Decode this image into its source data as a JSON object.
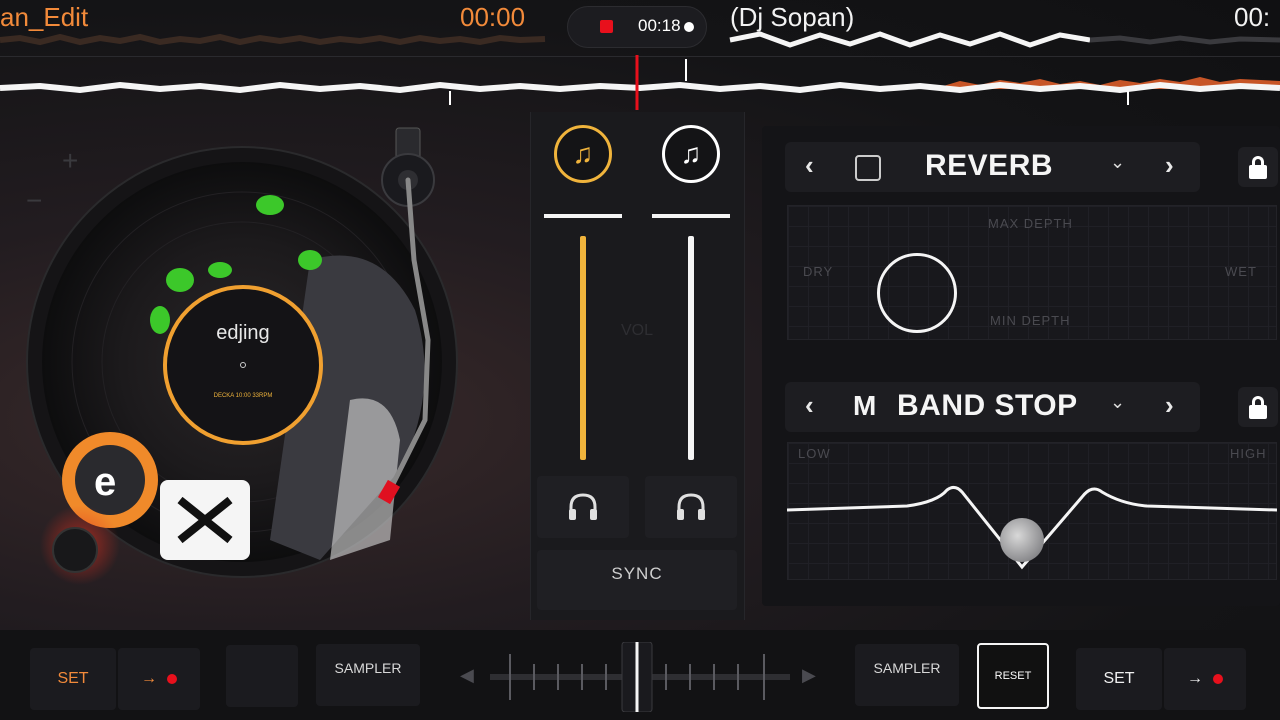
{
  "top": {
    "left_title": "an_Edit",
    "left_time": "00:00",
    "record_time": "00:18",
    "right_title": "(Dj Sopan)",
    "right_time": "00:"
  },
  "deck": {
    "label_brand": "edjing",
    "label_sub": "DECKA 10:00 33RPM",
    "plus_label": "+",
    "minus_label": "−"
  },
  "mixer": {
    "vol_label": "VOL",
    "sync_label": "SYNC",
    "left_music_icon": "music-note-icon",
    "right_music_icon": "music-note-icon",
    "accent": "#f0b43c"
  },
  "fx": {
    "top": {
      "name": "REVERB",
      "max_label": "MAX DEPTH",
      "min_label": "MIN DEPTH",
      "dry_label": "DRY",
      "wet_label": "WET"
    },
    "bottom": {
      "name": "BAND STOP",
      "low_label": "LOW",
      "high_label": "HIGH"
    }
  },
  "bottom": {
    "left_set": "SET",
    "left_sampler": "SAMPLER",
    "right_sampler": "SAMPLER",
    "reset": "RESET",
    "right_set": "SET",
    "arrow": "→"
  },
  "colors": {
    "accent_orange": "#f28a3a",
    "record_red": "#e8101c",
    "ring_orange": "#f0a030"
  }
}
